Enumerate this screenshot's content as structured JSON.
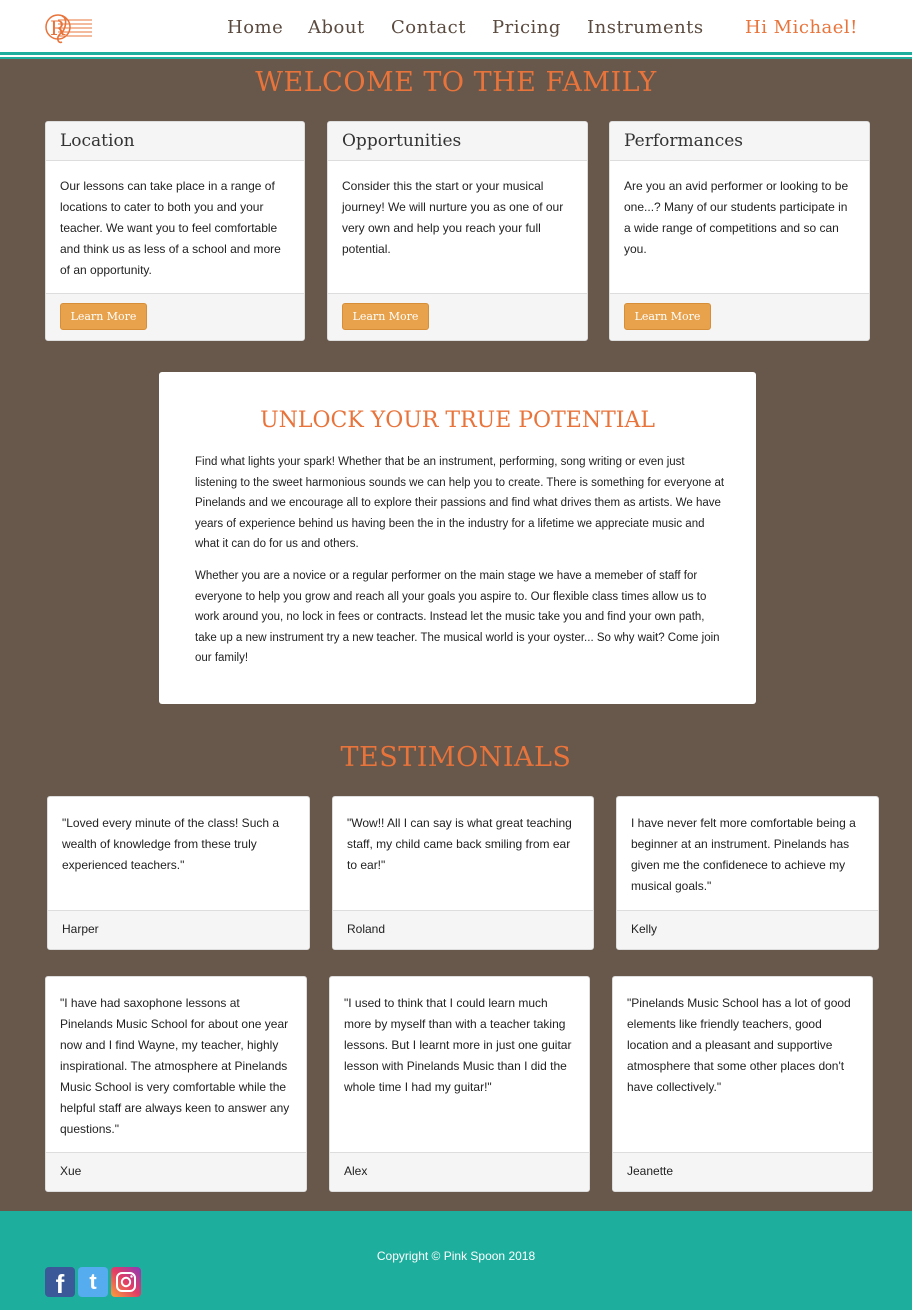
{
  "header": {
    "logo_letter": "R",
    "nav": [
      {
        "label": "Home"
      },
      {
        "label": "About"
      },
      {
        "label": "Contact"
      },
      {
        "label": "Pricing"
      },
      {
        "label": "Instruments"
      }
    ],
    "greeting": "Hi Michael!"
  },
  "welcome": {
    "title": "WELCOME TO THE FAMILY",
    "cards": [
      {
        "title": "Location",
        "text": "Our lessons can take place in a range of locations to cater to both you and your teacher. We want you to feel comfortable and think us as less of a school and more of an opportunity.",
        "button": "Learn More"
      },
      {
        "title": "Opportunities",
        "text": "Consider this the start or your musical journey! We will nurture you as one of our very own and help you reach your full potential.",
        "button": "Learn More"
      },
      {
        "title": "Performances",
        "text": "Are you an avid performer or looking to be one...? Many of our students participate in a wide range of competitions and so can you.",
        "button": "Learn More"
      }
    ]
  },
  "potential": {
    "title": "UNLOCK YOUR TRUE POTENTIAL",
    "paragraphs": [
      "Find what lights your spark! Whether that be an instrument, performing, song writing or even just listening to the sweet harmonious sounds we can help you to create. There is something for everyone at Pinelands and we encourage all to explore their passions and find what drives them as artists. We have years of experience behind us having been the in the industry for a lifetime we appreciate music and what it can do for us and others.",
      "Whether you are a novice or a regular performer on the main stage we have a memeber of staff for everyone to help you grow and reach all your goals you aspire to. Our flexible class times allow us to work around you, no lock in fees or contracts. Instead let the music take you and find your own path, take up a new instrument try a new teacher. The musical world is your oyster... So why wait? Come join our family!"
    ]
  },
  "testimonials": {
    "title": "TESTIMONIALS",
    "items": [
      {
        "quote": "\"Loved every minute of the class! Such a wealth of knowledge from these truly experienced teachers.\"",
        "name": "Harper"
      },
      {
        "quote": "\"Wow!! All I can say is what great teaching staff, my child came back smiling from ear to ear!\"",
        "name": "Roland"
      },
      {
        "quote": "I have never felt more comfortable being a beginner at an instrument. Pinelands has given me the confidenece to achieve my musical goals.\"",
        "name": "Kelly"
      },
      {
        "quote": "\"I have had saxophone lessons at Pinelands Music School for about one year now and I find Wayne, my teacher, highly inspirational. The atmosphere at Pinelands Music School is very comfortable while the helpful staff are always keen to answer any questions.\"",
        "name": "Xue"
      },
      {
        "quote": "\"I used to think that I could learn much more by myself than with a teacher taking lessons. But I learnt more in just one guitar lesson with Pinelands Music than I did the whole time I had my guitar!\"",
        "name": "Alex"
      },
      {
        "quote": "\"Pinelands Music School has a lot of good elements like friendly teachers, good location and a pleasant and supportive atmosphere that some other places don't have collectively.\"",
        "name": "Jeanette"
      }
    ]
  },
  "footer": {
    "copyright": "Copyright © Pink Spoon 2018",
    "social": [
      {
        "icon": "facebook-icon",
        "glyph": "f"
      },
      {
        "icon": "twitter-icon",
        "glyph": "t"
      },
      {
        "icon": "instagram-icon"
      }
    ]
  },
  "colors": {
    "background": "#68574b",
    "accent": "#e8743b",
    "button": "#e8a24c",
    "teal": "#1eae9d"
  }
}
